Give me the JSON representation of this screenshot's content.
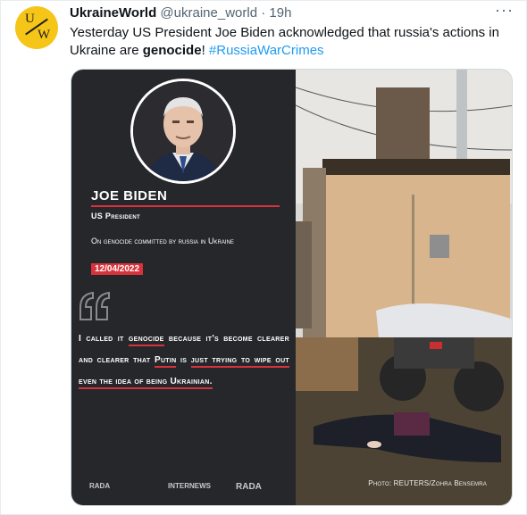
{
  "account": {
    "name": "UkraineWorld",
    "handle": "@ukraine_world",
    "separator": "·",
    "time": "19h",
    "avatar_letters": [
      "U",
      "W"
    ]
  },
  "tweet": {
    "text_part1": "Yesterday US President Joe Biden acknowledged that russia's actions in Ukraine are ",
    "text_bold": "genocide",
    "text_part2": "! ",
    "hashtag": "#RussiaWarCrimes"
  },
  "card": {
    "name": "JOE BIDEN",
    "role": "US President",
    "context": "On genocide committed by russia in Ukraine",
    "date": "12/04/2022",
    "quote": {
      "p1": "I called it ",
      "u1": "genocide",
      "p2": " because it's become clearer and clearer that ",
      "u2": "Putin",
      "p3": " is ",
      "u3": "just trying to wipe out even the idea of being Ukrainian."
    },
    "logos": [
      "RADA",
      "INTERNEWS",
      "RADA"
    ],
    "photo_credit": "Photo: REUTERS/Zohra Bensemra"
  },
  "colors": {
    "accent_red": "#d8323c",
    "link_blue": "#1d9bf0",
    "avatar_yellow": "#f5c518",
    "card_dark": "#26272b"
  }
}
